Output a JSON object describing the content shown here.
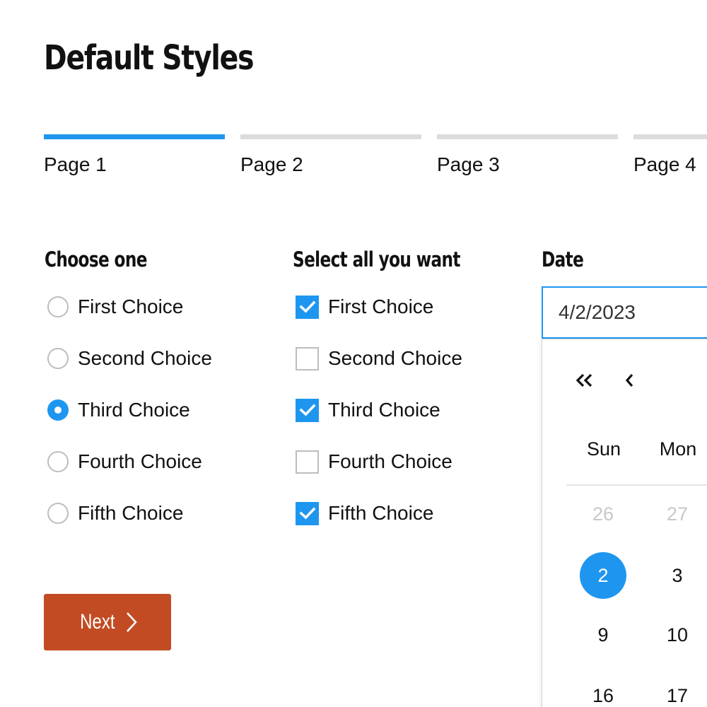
{
  "title": "Default Styles",
  "progress": {
    "steps": [
      {
        "label": "Page 1",
        "active": true
      },
      {
        "label": "Page 2",
        "active": false
      },
      {
        "label": "Page 3",
        "active": false
      },
      {
        "label": "Page 4",
        "active": false
      }
    ]
  },
  "radio_group": {
    "label": "Choose one",
    "options": [
      {
        "label": "First Choice",
        "checked": false
      },
      {
        "label": "Second Choice",
        "checked": false
      },
      {
        "label": "Third Choice",
        "checked": true
      },
      {
        "label": "Fourth Choice",
        "checked": false
      },
      {
        "label": "Fifth Choice",
        "checked": false
      }
    ]
  },
  "checkbox_group": {
    "label": "Select all you want",
    "options": [
      {
        "label": "First Choice",
        "checked": true
      },
      {
        "label": "Second Choice",
        "checked": false
      },
      {
        "label": "Third Choice",
        "checked": true
      },
      {
        "label": "Fourth Choice",
        "checked": false
      },
      {
        "label": "Fifth Choice",
        "checked": true
      }
    ]
  },
  "date": {
    "label": "Date",
    "value": "4/2/2023",
    "calendar": {
      "weekdays": [
        "Sun",
        "Mon"
      ],
      "rows": [
        [
          {
            "day": "26",
            "muted": true
          },
          {
            "day": "27",
            "muted": true
          }
        ],
        [
          {
            "day": "2",
            "selected": true
          },
          {
            "day": "3"
          }
        ],
        [
          {
            "day": "9"
          },
          {
            "day": "10"
          }
        ],
        [
          {
            "day": "16"
          },
          {
            "day": "17"
          }
        ]
      ]
    }
  },
  "next_button": {
    "label": "Next"
  },
  "colors": {
    "accent": "#1e96f0",
    "button": "#c24b23",
    "inactive_bar": "#dcdcdc"
  }
}
